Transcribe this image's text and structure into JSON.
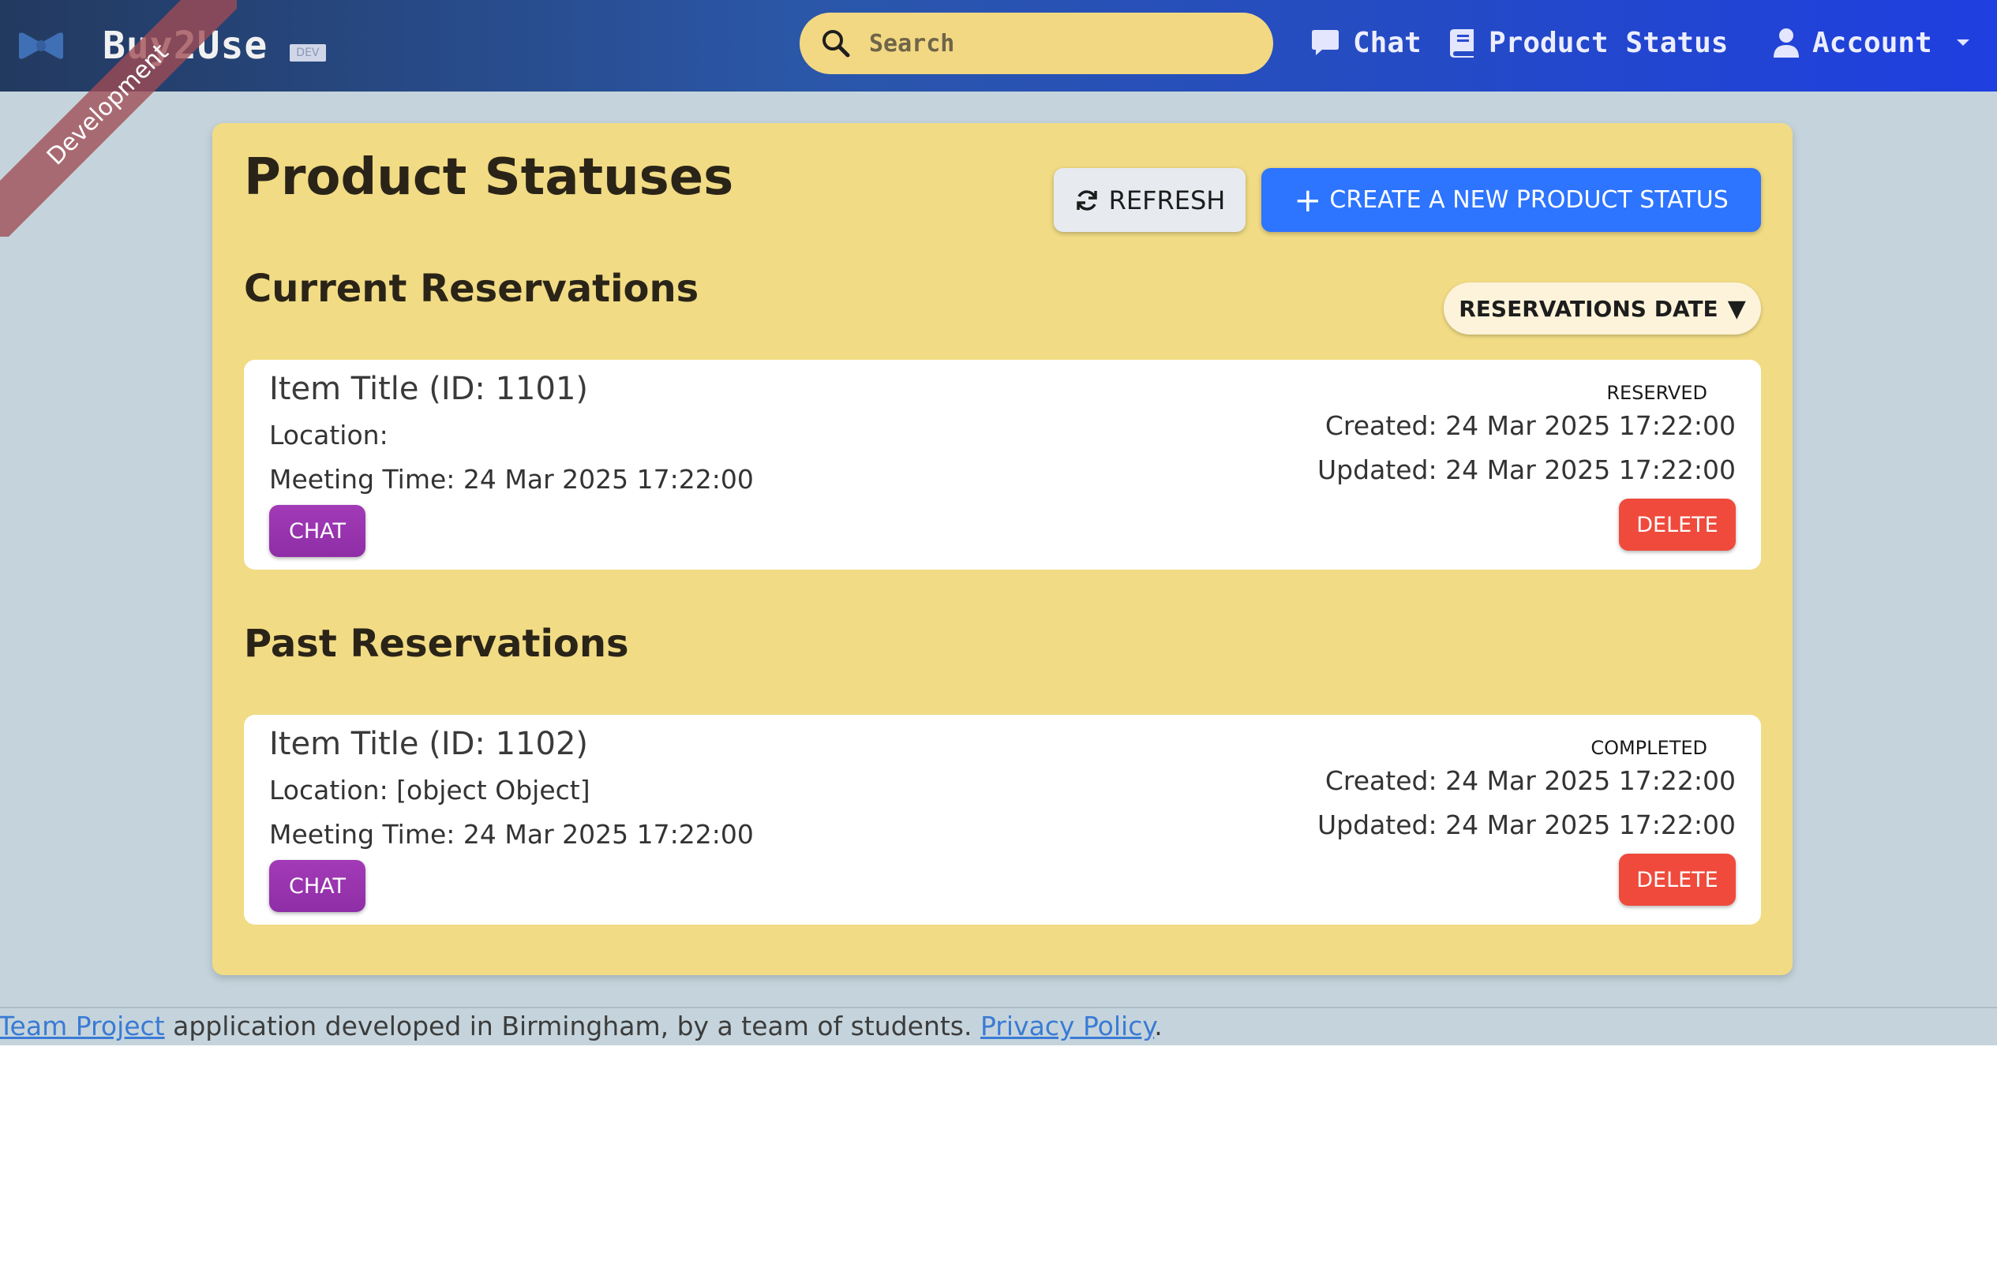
{
  "navbar": {
    "brand": "Buy2Use",
    "brand_tag": "DEV",
    "search_placeholder": "Search",
    "links": {
      "chat": "Chat",
      "product_status": "Product Status",
      "account": "Account"
    },
    "ribbon": "Development"
  },
  "page": {
    "title": "Product Statuses",
    "refresh_label": "REFRESH",
    "create_label": "CREATE A NEW PRODUCT STATUS",
    "current_title": "Current Reservations",
    "past_title": "Past Reservations",
    "sort_label": "RESERVATIONS DATE",
    "sort_caret": "▼"
  },
  "reservations": {
    "current": [
      {
        "title": "Item Title (ID: 1101)",
        "location": "Location:",
        "meeting": "Meeting Time: 24 Mar 2025 17:22:00",
        "status": "RESERVED",
        "created": "Created: 24 Mar 2025 17:22:00",
        "updated": "Updated: 24 Mar 2025 17:22:00",
        "chat_label": "CHAT",
        "delete_label": "DELETE"
      }
    ],
    "past": [
      {
        "title": "Item Title (ID: 1102)",
        "location": "Location: [object Object]",
        "meeting": "Meeting Time: 24 Mar 2025 17:22:00",
        "status": "COMPLETED",
        "created": "Created: 24 Mar 2025 17:22:00",
        "updated": "Updated: 24 Mar 2025 17:22:00",
        "chat_label": "CHAT",
        "delete_label": "DELETE"
      }
    ]
  },
  "footer": {
    "link1": "Team Project",
    "text": " application developed in Birmingham, by a team of students. ",
    "link2": "Privacy Policy",
    "end": "."
  },
  "colors": {
    "nav_start": "#233a5f",
    "nav_end": "#1f3fe0",
    "search_bg": "#f2d883",
    "card_bg": "#f1db84",
    "page_bg": "#c5d4dc",
    "create_btn": "#2d74ff",
    "chat_btn": "#9a34b0",
    "delete_btn": "#ef4a3c"
  },
  "icons": {
    "brand": "bowtie-icon",
    "search": "search-icon",
    "chat": "chat-bubble-icon",
    "product_status": "book-icon",
    "account": "user-icon",
    "account_menu": "caret-down-icon",
    "refresh": "refresh-icon",
    "create": "plus-icon"
  }
}
